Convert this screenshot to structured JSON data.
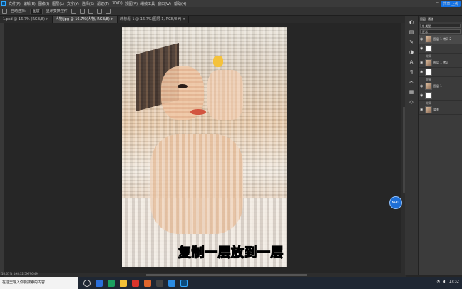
{
  "menubar": {
    "items": [
      "文件(F)",
      "编辑(E)",
      "图像(I)",
      "图层(L)",
      "文字(Y)",
      "选择(S)",
      "滤镜(T)",
      "3D(D)",
      "视图(V)",
      "增效工具",
      "窗口(W)",
      "帮助(H)"
    ],
    "share_label": "共享 上传"
  },
  "options": {
    "auto_select_label": "自动选择:",
    "target": "图层",
    "transform_label": "显示变换控件"
  },
  "tabs": [
    {
      "label": "1.psd @ 16.7% (RGB/8) ×"
    },
    {
      "label": "人物.jpg @ 16.7%(人物, RGB/8) ×"
    },
    {
      "label": "未标题-1 @ 16.7%(图层 1, RGB/8#) ×"
    }
  ],
  "status": "16.67%   文档:32.5M/96.4M",
  "caption": "复制一层放到一层",
  "layers_panel": {
    "tab1": "图层",
    "tab2": "通道",
    "search": "Q 类型",
    "mode": "正常",
    "layers": [
      {
        "name": "图层 1 拷贝 2",
        "selected": true,
        "fx": "效果"
      },
      {
        "name": "图层 1 拷贝",
        "selected": false,
        "fx": "效果"
      },
      {
        "name": "图层 1",
        "selected": false,
        "fx": "效果"
      },
      {
        "name": "背景",
        "selected": false,
        "fx": ""
      }
    ]
  },
  "blue_badge": "NEXT",
  "taskbar": {
    "search_text": "在这里输入你要搜索的内容",
    "tray_time": "17:32"
  },
  "colors": {
    "accent": "#1473e6",
    "panel_bg": "#3b3b3b",
    "canvas_bg": "#262626"
  }
}
